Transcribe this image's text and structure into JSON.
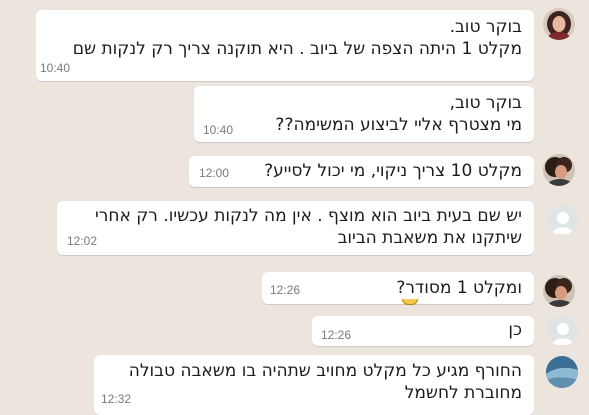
{
  "messages": [
    {
      "lines": [
        "בוקר טוב.",
        "מקלט 1 היתה הצפה של ביוב . היא תוקנה צריך רק לנקות שם"
      ],
      "time": "10:40",
      "avatar": "woman-dark-hair-avatar"
    },
    {
      "lines": [
        "בוקר טוב,",
        "מי מצטרף אליי לביצוע המשימה??"
      ],
      "time": "10:40",
      "avatar": null
    },
    {
      "lines": [
        "מקלט 10 צריך ניקוי, מי יכול לסייע?"
      ],
      "time": "12:00",
      "avatar": "woman-curly-hair-avatar"
    },
    {
      "lines": [
        "יש שם בעית ביוב הוא מוצף . אין מה לנקות עכשיו. רק אחרי",
        "שיתקנו את משאבת הביוב"
      ],
      "time": "12:02",
      "avatar": "default-user-avatar"
    },
    {
      "lines": [
        "ומקלט 1 מסודר?"
      ],
      "time": "12:26",
      "avatar": "woman-curly-hair-avatar"
    },
    {
      "lines": [
        "כן"
      ],
      "time": "12:26",
      "avatar": "default-user-avatar"
    },
    {
      "lines": [
        "החורף מגיע כל מקלט מחויב שתהיה בו משאבה טבולה",
        "מחוברת לחשמל"
      ],
      "time": "12:32",
      "avatar": "landscape-photo-avatar"
    }
  ],
  "colors": {
    "background": "#ebe5de",
    "bubble": "#ffffff",
    "timestamp": "#7a7a7a"
  }
}
